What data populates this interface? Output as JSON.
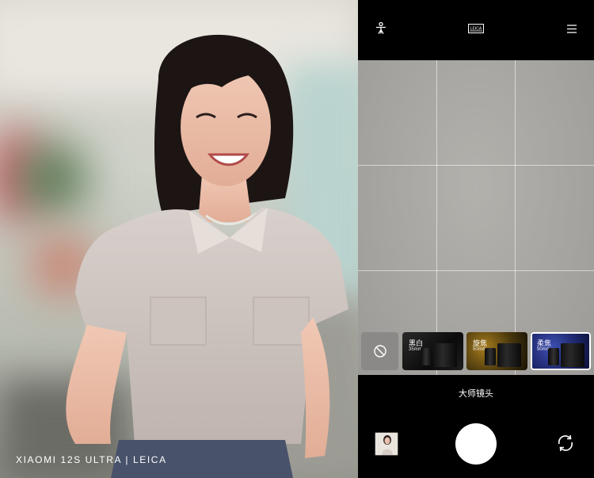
{
  "photo": {
    "watermark": "XIAOMI 12S ULTRA | LEICA"
  },
  "camera": {
    "topbar": {
      "icons": [
        "person-frame-icon",
        "leica-logo",
        "menu-icon"
      ],
      "logo_text": "LEICA"
    },
    "lenses": [
      {
        "icon": "no-filter-icon",
        "label": "",
        "focal": ""
      },
      {
        "label": "黑白",
        "focal": "35mm"
      },
      {
        "label": "旋焦",
        "focal": "50mm"
      },
      {
        "label": "柔焦",
        "focal": "90mm",
        "selected": true
      }
    ],
    "mode_label": "大师镜头",
    "bottom": {
      "icons": [
        "gallery-thumbnail",
        "shutter-button",
        "switch-camera-icon"
      ]
    }
  },
  "colors": {
    "panel_bg": "#000000",
    "viewfinder": "#a9a7a3",
    "grid": "#ffffff"
  }
}
